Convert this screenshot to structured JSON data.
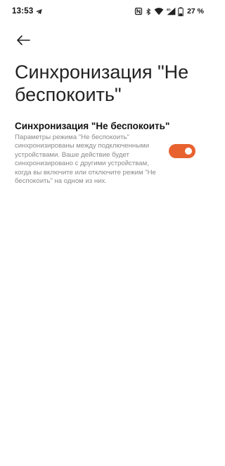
{
  "status_bar": {
    "time": "13:53",
    "battery": "27 %",
    "icons": [
      "telegram-icon",
      "nfc-icon",
      "bluetooth-icon",
      "wifi-icon",
      "signal-icon",
      "battery-icon"
    ]
  },
  "header": {
    "back_icon": "arrow-left-icon",
    "title": "Синхронизация \"Не беспокоить\""
  },
  "setting": {
    "title": "Синхронизация \"Не беспокоить\"",
    "description": "Параметры режима \"Не беспокоить\" синхронизированы между подключенными устройствами. Ваше действие будет синхронизировано с другими устройствам, когда вы включите или отключите режим \"Не беспокоить\" на одном из них.",
    "enabled": true
  },
  "colors": {
    "accent": "#e8622f",
    "background": "#ffffff"
  }
}
